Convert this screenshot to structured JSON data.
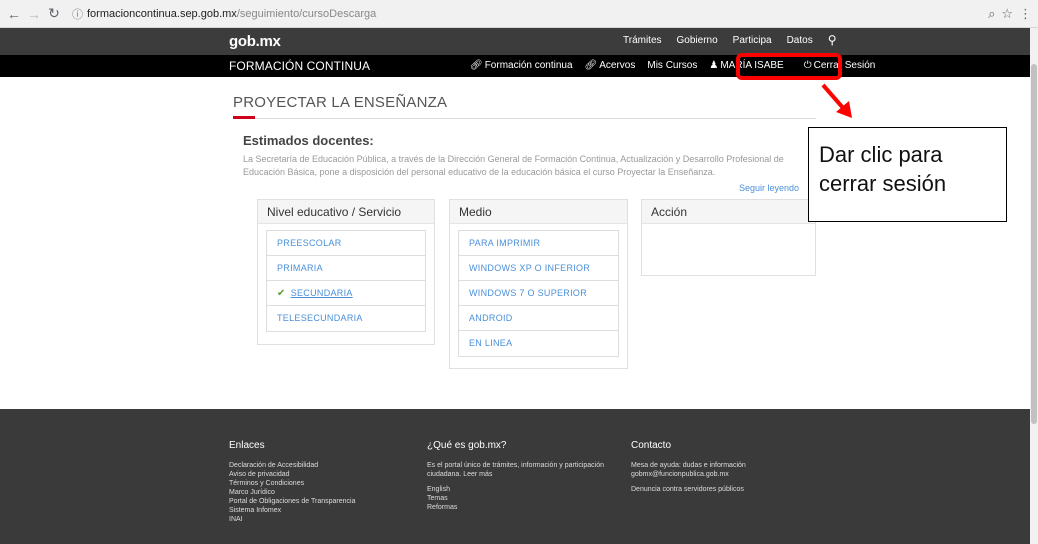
{
  "browser": {
    "url_host": "formacioncontinua.sep.gob.mx",
    "url_path": "/seguimiento/cursoDescarga"
  },
  "gob_header": {
    "logo": "gob.mx",
    "nav": [
      "Trámites",
      "Gobierno",
      "Participa",
      "Datos"
    ]
  },
  "fc_header": {
    "title": "FORMACIÓN CONTINUA",
    "nav": {
      "formacion": "Formación continua",
      "acervos": "Acervos",
      "mis_cursos": "Mis Cursos",
      "user": "MARÍA ISABE",
      "logout": "Cerrar Sesión"
    }
  },
  "main": {
    "title": "PROYECTAR LA ENSEÑANZA",
    "greeting": "Estimados docentes:",
    "intro": "La Secretaría de Educación Pública, a través de la Dirección General de Formación Continua, Actualización y Desarrollo Profesional de Educación Básica, pone a disposición del personal educativo de la educación básica el curso Proyectar la Enseñanza.",
    "read_more": "Seguir leyendo"
  },
  "panels": {
    "nivel": {
      "heading": "Nivel educativo / Servicio",
      "items": [
        "PREESCOLAR",
        "PRIMARIA",
        "SECUNDARIA",
        "TELESECUNDARIA"
      ],
      "selected": "SECUNDARIA"
    },
    "medio": {
      "heading": "Medio",
      "items": [
        "PARA IMPRIMIR",
        "WINDOWS XP O INFERIOR",
        "WINDOWS 7 O SUPERIOR",
        "ANDROID",
        "EN LINEA"
      ]
    },
    "accion": {
      "heading": "Acción"
    }
  },
  "callout": {
    "text": "Dar clic para cerrar sesión"
  },
  "footer": {
    "enlaces": {
      "heading": "Enlaces",
      "links": [
        "Declaración de Accesibilidad",
        "Aviso de privacidad",
        "Términos y Condiciones",
        "Marco Jurídico",
        "Portal de Obligaciones de Transparencia",
        "Sistema Infomex",
        "INAI"
      ]
    },
    "que_es": {
      "heading": "¿Qué es gob.mx?",
      "text": "Es el portal único de trámites, información y participación ciudadana. Leer más",
      "links": [
        "English",
        "Temas",
        "Reformas"
      ]
    },
    "contacto": {
      "heading": "Contacto",
      "text": "Mesa de ayuda: dudas e información gobmx@funcionpublica.gob.mx",
      "link": "Denuncia contra servidores públicos"
    }
  },
  "colors": {
    "accent_red": "#ff0000",
    "link_blue": "#4a90d9",
    "footer_bg": "#3a3a3a"
  }
}
